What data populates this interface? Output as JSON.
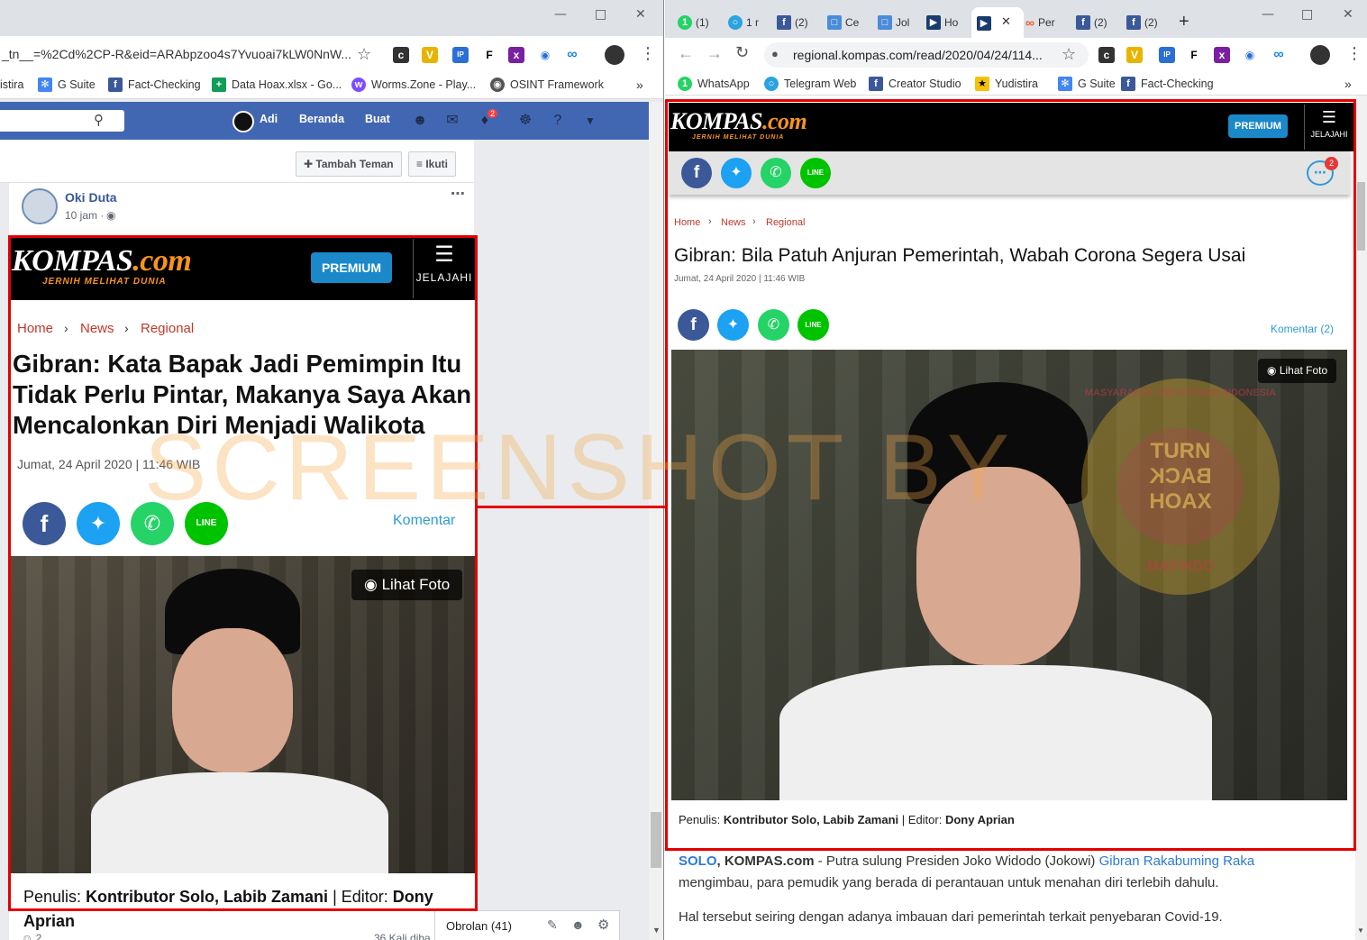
{
  "left": {
    "url": "_tn__=%2Cd%2CP-R&eid=ARAbpzoo4s7Yvuoai7kLW0NnW...",
    "bookmarks": [
      {
        "label": "istira",
        "icon": "",
        "color": ""
      },
      {
        "label": "G Suite",
        "icon": "gsuite-icon",
        "color": "#4285f4"
      },
      {
        "label": "Fact-Checking",
        "icon": "facebook-icon",
        "color": "#3b5998"
      },
      {
        "label": "Data Hoax.xlsx - Go...",
        "icon": "sheets-icon",
        "color": "#0f9d58"
      },
      {
        "label": "Worms.Zone - Play...",
        "icon": "worms-icon",
        "color": "#7c4dff"
      },
      {
        "label": "OSINT Framework",
        "icon": "globe-icon",
        "color": "#555555"
      }
    ],
    "fb": {
      "user": "Adi",
      "nav_home": "Beranda",
      "nav_create": "Buat",
      "notif_count": "2",
      "add_friend": "Tambah Teman",
      "follow": "Ikuti"
    },
    "post": {
      "author": "Oki Duta",
      "time": "10 jam ·",
      "chat_label": "Obrolan (41)",
      "reaction_count": "2",
      "share_count": "36 Kali diba"
    },
    "article": {
      "logo_main": "KOMPAS",
      "logo_dot": ".com",
      "tagline": "JERNIH MELIHAT DUNIA",
      "premium": "PREMIUM",
      "explore": "JELAJAHI",
      "crumbs": [
        "Home",
        "News",
        "Regional"
      ],
      "title": "Gibran: Kata Bapak Jadi Pemimpin Itu Tidak Perlu Pintar, Makanya Saya Akan Mencalonkan Diri Menjadi Walikota",
      "date": "Jumat, 24 April 2020 | 11:46 WIB",
      "comment": "Komentar",
      "photo_btn": "Lihat Foto",
      "author_prefix": "Penulis:",
      "author": "Kontributor Solo, Labib Zamani",
      "editor_prefix": "| Editor:",
      "editor": "Dony",
      "editor_rest": "Aprian"
    }
  },
  "right": {
    "tabs": [
      "(1)",
      "1 r",
      "(2)",
      "Ce",
      "Jol",
      "Ho",
      "",
      "Per",
      "(2)",
      "(2)"
    ],
    "url": "regional.kompas.com/read/2020/04/24/114...",
    "bookmarks": [
      {
        "label": "WhatsApp",
        "icon": "whatsapp-icon",
        "color": "#25d366"
      },
      {
        "label": "Telegram Web",
        "icon": "telegram-icon",
        "color": "#2aa3df"
      },
      {
        "label": "Creator Studio",
        "icon": "facebook-icon",
        "color": "#3b5998"
      },
      {
        "label": "Yudistira",
        "icon": "yudistira-icon",
        "color": "#f4c20d"
      },
      {
        "label": "G Suite",
        "icon": "gsuite-icon",
        "color": "#4285f4"
      },
      {
        "label": "Fact-Checking",
        "icon": "facebook-icon",
        "color": "#3b5998"
      }
    ],
    "chat_count": "2",
    "article": {
      "logo_main": "KOMPAS",
      "logo_dot": ".com",
      "tagline": "JERNIH MELIHAT DUNIA",
      "premium": "PREMIUM",
      "explore": "JELAJAHI",
      "crumbs": [
        "Home",
        "News",
        "Regional"
      ],
      "title": "Gibran: Bila Patuh Anjuran Pemerintah, Wabah Corona Segera Usai",
      "date": "Jumat, 24 April 2020 | 11:46 WIB",
      "comment": "Komentar (2)",
      "photo_btn": "Lihat Foto",
      "author_prefix": "Penulis:",
      "author": "Kontributor Solo, Labib Zamani",
      "editor_prefix": "| Editor:",
      "editor": "Dony Aprian",
      "body_city": "SOLO",
      "body_source": ", KOMPAS.com",
      "body_1a": " - Putra sulung Presiden Joko Widodo (Jokowi) ",
      "body_link": "Gibran Rakabuming Raka",
      "body_1b": "mengimbau, para pemudik yang berada di perantauan untuk menahan diri terlebih dahulu.",
      "body_2": "Hal tersebut seiring dengan adanya imbauan dari pemerintah terkait penyebaran Covid-19."
    }
  },
  "watermark": "SCREENSHOT BY",
  "seal": {
    "arc_top": "MASYARAKAT ANTI FITNAH INDONESIA",
    "arc_bottom": "MAFINDO",
    "center": [
      "TURN",
      "BACK",
      "HOAX"
    ]
  },
  "colors": {
    "red_box": "#e50000",
    "kompas_orange": "#f7941d",
    "premium_blue": "#1a88c9",
    "fb_blue": "#4267b2",
    "crumb_red": "#c0392b",
    "comment_blue": "#2e9bd6"
  }
}
